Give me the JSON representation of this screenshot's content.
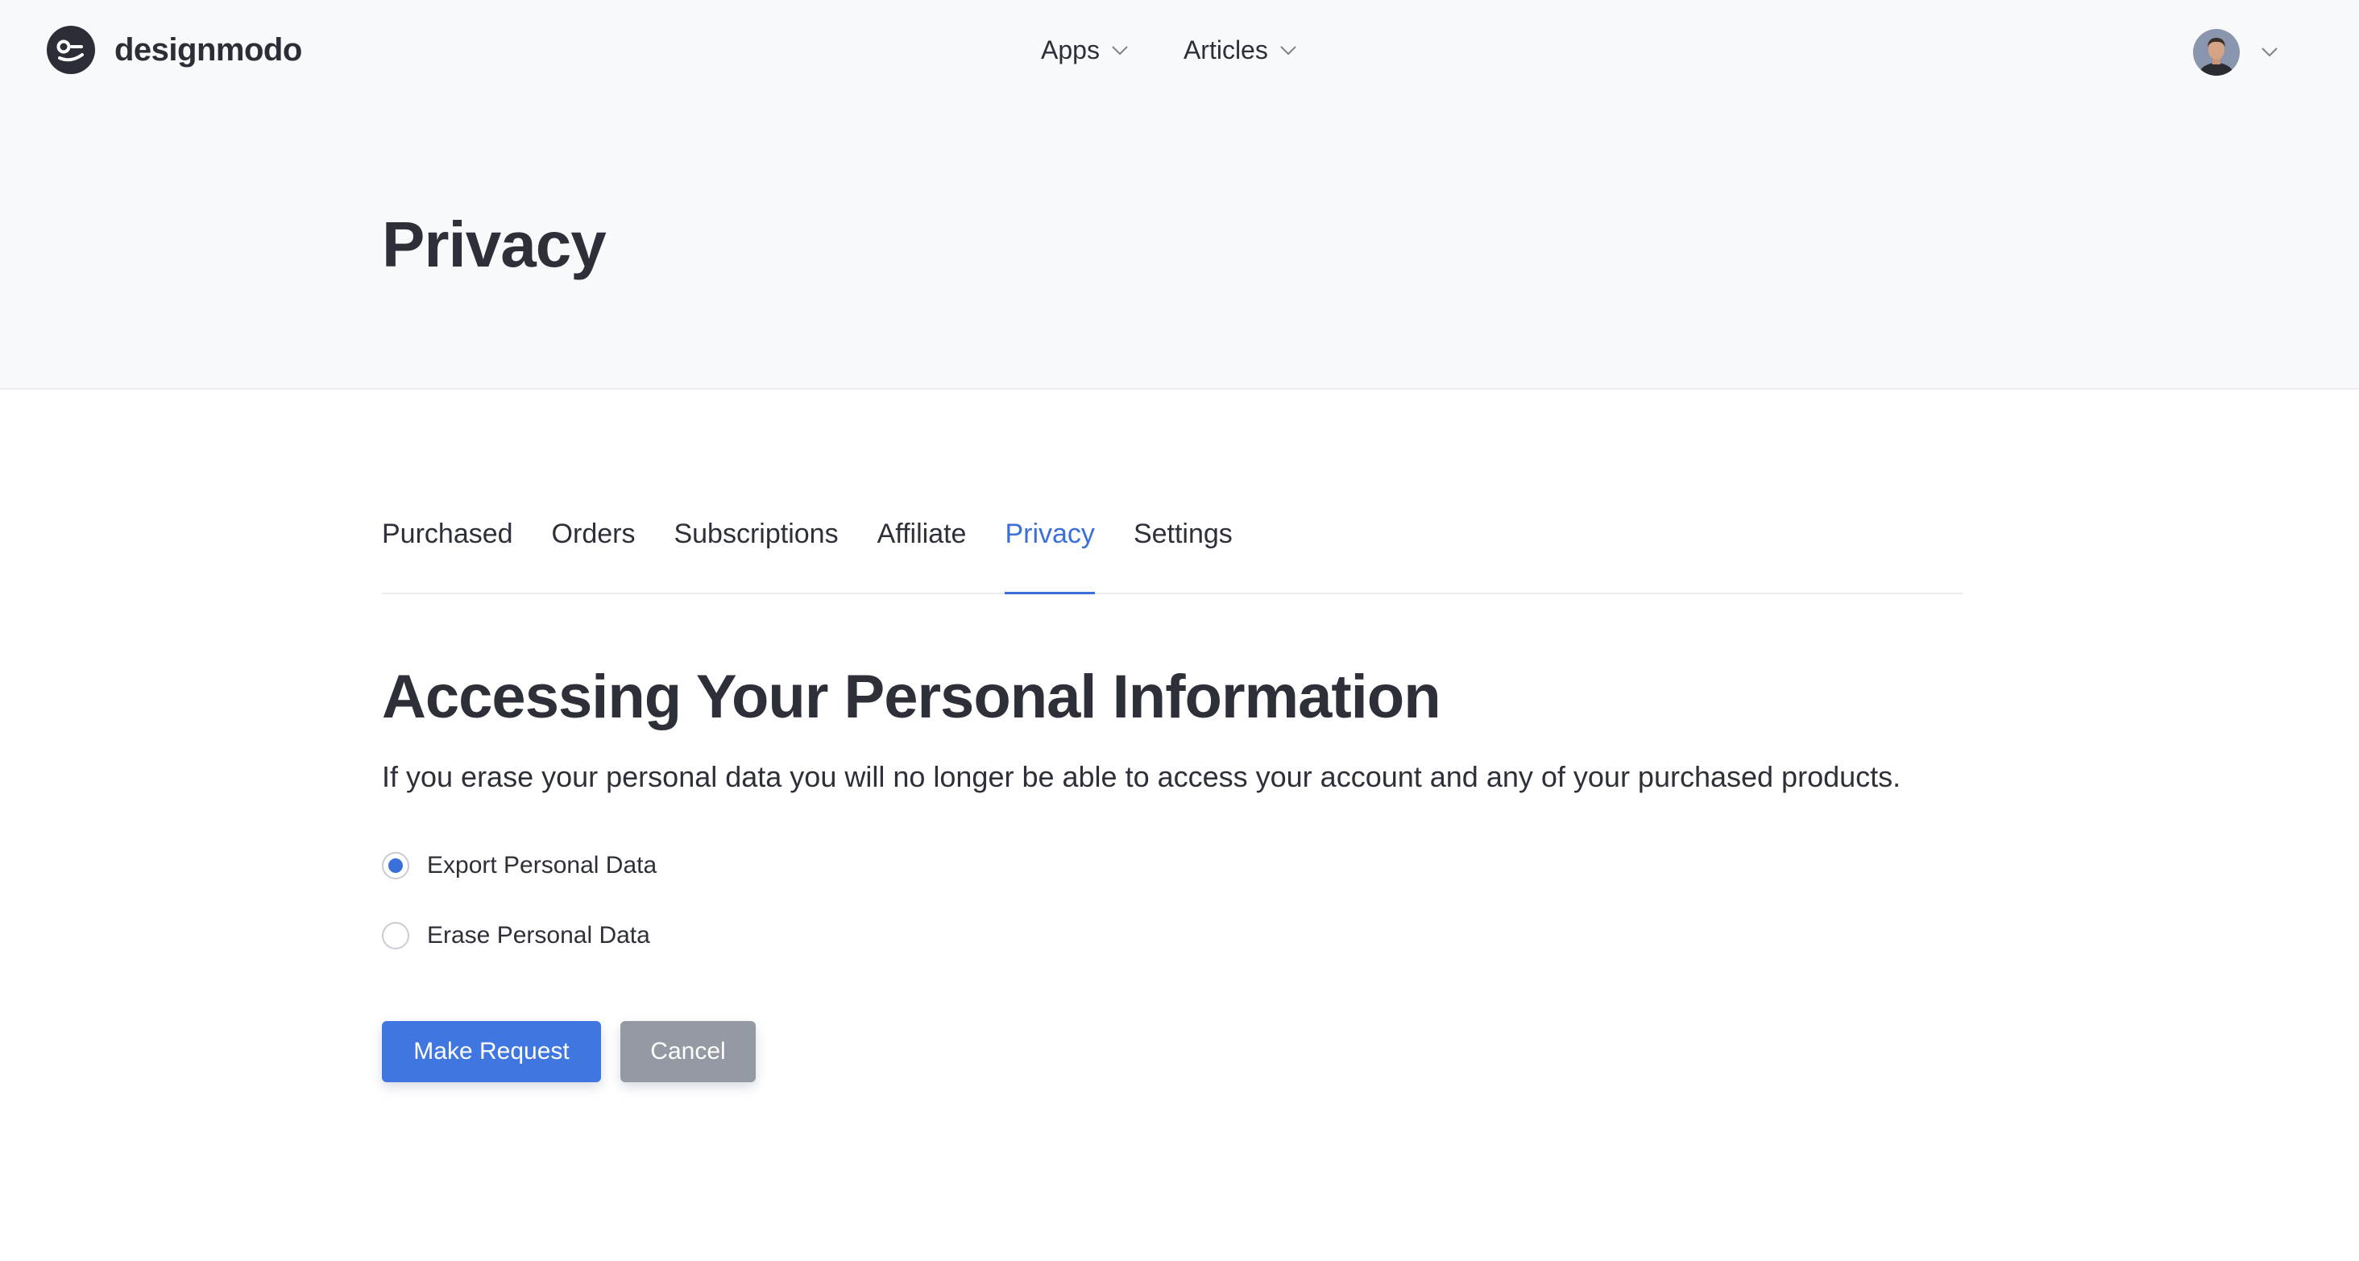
{
  "brand": {
    "name": "designmodo"
  },
  "nav": {
    "items": [
      {
        "label": "Apps"
      },
      {
        "label": "Articles"
      }
    ]
  },
  "page": {
    "title": "Privacy"
  },
  "tabs": [
    {
      "label": "Purchased",
      "active": false
    },
    {
      "label": "Orders",
      "active": false
    },
    {
      "label": "Subscriptions",
      "active": false
    },
    {
      "label": "Affiliate",
      "active": false
    },
    {
      "label": "Privacy",
      "active": true
    },
    {
      "label": "Settings",
      "active": false
    }
  ],
  "section": {
    "title": "Accessing Your Personal Information",
    "description": "If you erase your personal data you will no longer be able to access your account and any of your purchased products."
  },
  "options": [
    {
      "label": "Export Personal Data",
      "checked": true
    },
    {
      "label": "Erase Personal Data",
      "checked": false
    }
  ],
  "actions": {
    "primary_label": "Make Request",
    "secondary_label": "Cancel"
  },
  "colors": {
    "accent": "#3b6fd9",
    "header_bg": "#f8f9fb",
    "text": "#2d3038",
    "secondary_button": "#9499a4"
  },
  "icons": {
    "logo": "designmodo-logo-icon",
    "dropdown": "chevron-down-icon",
    "avatar": "user-avatar"
  }
}
